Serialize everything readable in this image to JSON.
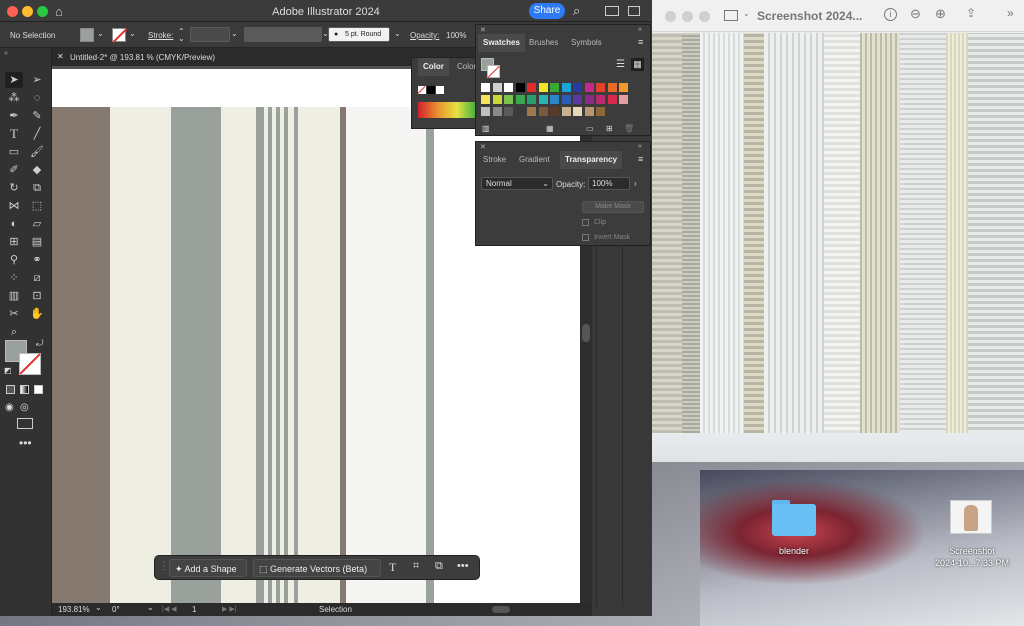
{
  "app": {
    "title": "Adobe Illustrator 2024",
    "share_label": "Share"
  },
  "controlbar": {
    "selection": "No Selection",
    "stroke_label": "Stroke:",
    "brush": "5 pt. Round",
    "opacity_label": "Opacity:",
    "opacity_value": "100%"
  },
  "document": {
    "tab_title": "Untitled-2* @ 193.81 % (CMYK/Preview)"
  },
  "color_panel": {
    "tabs": [
      "Color",
      "Color"
    ]
  },
  "swatches_panel": {
    "tabs": [
      "Swatches",
      "Brushes",
      "Symbols"
    ]
  },
  "transparency_panel": {
    "tabs": [
      "Stroke",
      "Gradient",
      "Transparency"
    ],
    "blend_mode": "Normal",
    "opacity_label": "Opacity:",
    "opacity_value": "100%",
    "make_mask": "Make Mask",
    "clip": "Clip",
    "invert_mask": "Invert Mask"
  },
  "context_bar": {
    "add_shape": "Add a Shape",
    "generate_vectors": "Generate Vectors (Beta)"
  },
  "status": {
    "zoom": "193.81%",
    "rotation": "0°",
    "artboard": "1",
    "tool": "Selection"
  },
  "preview": {
    "title": "Screenshot 2024..."
  },
  "desktop": {
    "folder_label": "blender",
    "file_label_1": "Screenshot",
    "file_label_2": "2024-10...7.33 PM",
    "colors": {
      "accent": "#2f7bf5",
      "stripe_taupe": "#857970",
      "stripe_cream": "#efeee2",
      "stripe_gray": "#9aa09b"
    }
  }
}
